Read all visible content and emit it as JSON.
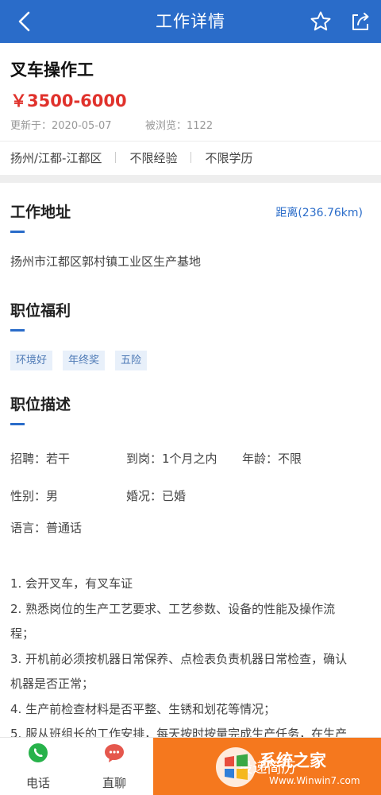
{
  "header": {
    "title": "工作详情"
  },
  "job": {
    "title": "叉车操作工",
    "salary": "￥3500-6000",
    "updated": "更新于：2020-05-07",
    "views": "被浏览：1122",
    "location": "扬州/江都-江都区",
    "experience": "不限经验",
    "education": "不限学历"
  },
  "address_section": {
    "title": "工作地址",
    "distance": "距离(236.76km)",
    "address": "扬州市江都区郭村镇工业区生产基地"
  },
  "benefits_section": {
    "title": "职位福利",
    "tags": [
      "环境好",
      "年终奖",
      "五险"
    ]
  },
  "description_section": {
    "title": "职位描述",
    "fields": {
      "recruit": "招聘：若干",
      "arrival": "到岗：1个月之内",
      "age": "年龄：不限",
      "gender": "性别：男",
      "marital": "婚况：已婚",
      "language": "语言：普通话"
    },
    "lines": [
      "1. 会开叉车，有叉车证",
      "2. 熟悉岗位的生产工艺要求、工艺参数、设备的性能及操作流",
      "程；",
      "3. 开机前必须按机器日常保养、点检表负责机器日常检查，确认",
      "机器是否正常；",
      "4. 生产前检查材料是否平整、生锈和划花等情况；",
      "5. 服从班组长的工作安排，每天按时按量完成生产任务，在生产"
    ]
  },
  "bottom_bar": {
    "phone_label": "电话",
    "chat_label": "直聊",
    "apply_label": "投递简历"
  },
  "watermark": {
    "main": "系统之家",
    "sub": "Www.Winwin7.com"
  },
  "colors": {
    "primary": "#2a6cc9",
    "salary": "#e0322c",
    "apply": "#f5781e",
    "phone_icon": "#27b24a",
    "chat_icon": "#e5574d"
  }
}
